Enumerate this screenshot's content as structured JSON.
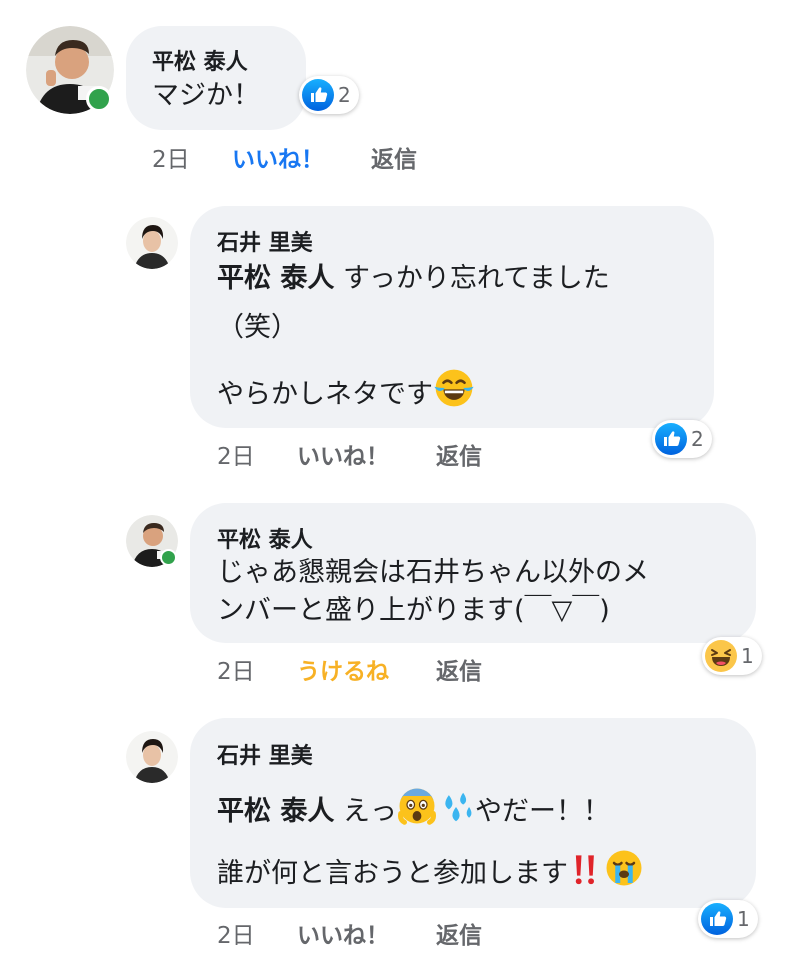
{
  "comments": [
    {
      "author": "平松 泰人",
      "text": "マジか！",
      "time": "2日",
      "like_label": "いいね！",
      "reply_label": "返信",
      "reaction_count": "2",
      "reaction_icon": "like-icon"
    },
    {
      "author": "石井 里美",
      "mention": "平松 泰人",
      "line1": "すっかり忘れてました",
      "line2": "（笑）",
      "line3": "やらかしネタです",
      "time": "2日",
      "like_label": "いいね！",
      "reply_label": "返信",
      "reaction_count": "2",
      "reaction_icon": "like-icon"
    },
    {
      "author": "平松 泰人",
      "line1": "じゃあ懇親会は石井ちゃん以外のメ",
      "line2": "ンバーと盛り上がります(￣▽￣)",
      "time": "2日",
      "like_label": "うけるね",
      "reply_label": "返信",
      "reaction_count": "1",
      "reaction_icon": "haha-icon"
    },
    {
      "author": "石井 里美",
      "mention": "平松 泰人",
      "line1": "えっ",
      "line1b": "やだー！！",
      "line2": "誰が何と言おうと参加します",
      "time": "2日",
      "like_label": "いいね！",
      "reply_label": "返信",
      "reaction_count": "1",
      "reaction_icon": "like-icon"
    }
  ],
  "colors": {
    "bubble": "#f0f2f5",
    "like_blue": "#1877f2",
    "haha_yellow": "#f7b125",
    "online_green": "#31a24c",
    "meta_gray": "#65676b"
  }
}
